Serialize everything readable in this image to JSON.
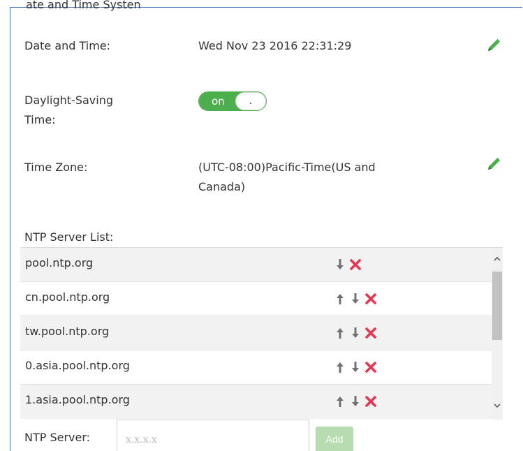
{
  "header": {
    "partial_title": "ate and Time Systen"
  },
  "datetime": {
    "label": "Date and Time:",
    "value": "Wed Nov 23 2016 22:31:29"
  },
  "dst": {
    "label_line1": "Daylight-Saving",
    "label_line2": "Time:",
    "toggle_on": "on",
    "toggle_knob": "."
  },
  "timezone": {
    "label": "Time Zone:",
    "value_line1": "(UTC-08:00)Pacific-Time(US and",
    "value_line2": "Canada)"
  },
  "ntp_list": {
    "label": "NTP Server List:",
    "servers": [
      "pool.ntp.org",
      "cn.pool.ntp.org",
      "tw.pool.ntp.org",
      "0.asia.pool.ntp.org",
      "1.asia.pool.ntp.org"
    ]
  },
  "ntp_add": {
    "label": "NTP Server:",
    "placeholder": "x.x.x.x",
    "add_label": "Add"
  },
  "icons": {
    "edit": "pencil-icon",
    "up": "arrow-up-icon",
    "down": "arrow-down-icon",
    "delete": "delete-x-icon"
  },
  "colors": {
    "accent_green": "#4cae4c",
    "delete_red": "#e8344e",
    "arrow_gray": "#707070",
    "panel_border": "#4a7ab5"
  }
}
